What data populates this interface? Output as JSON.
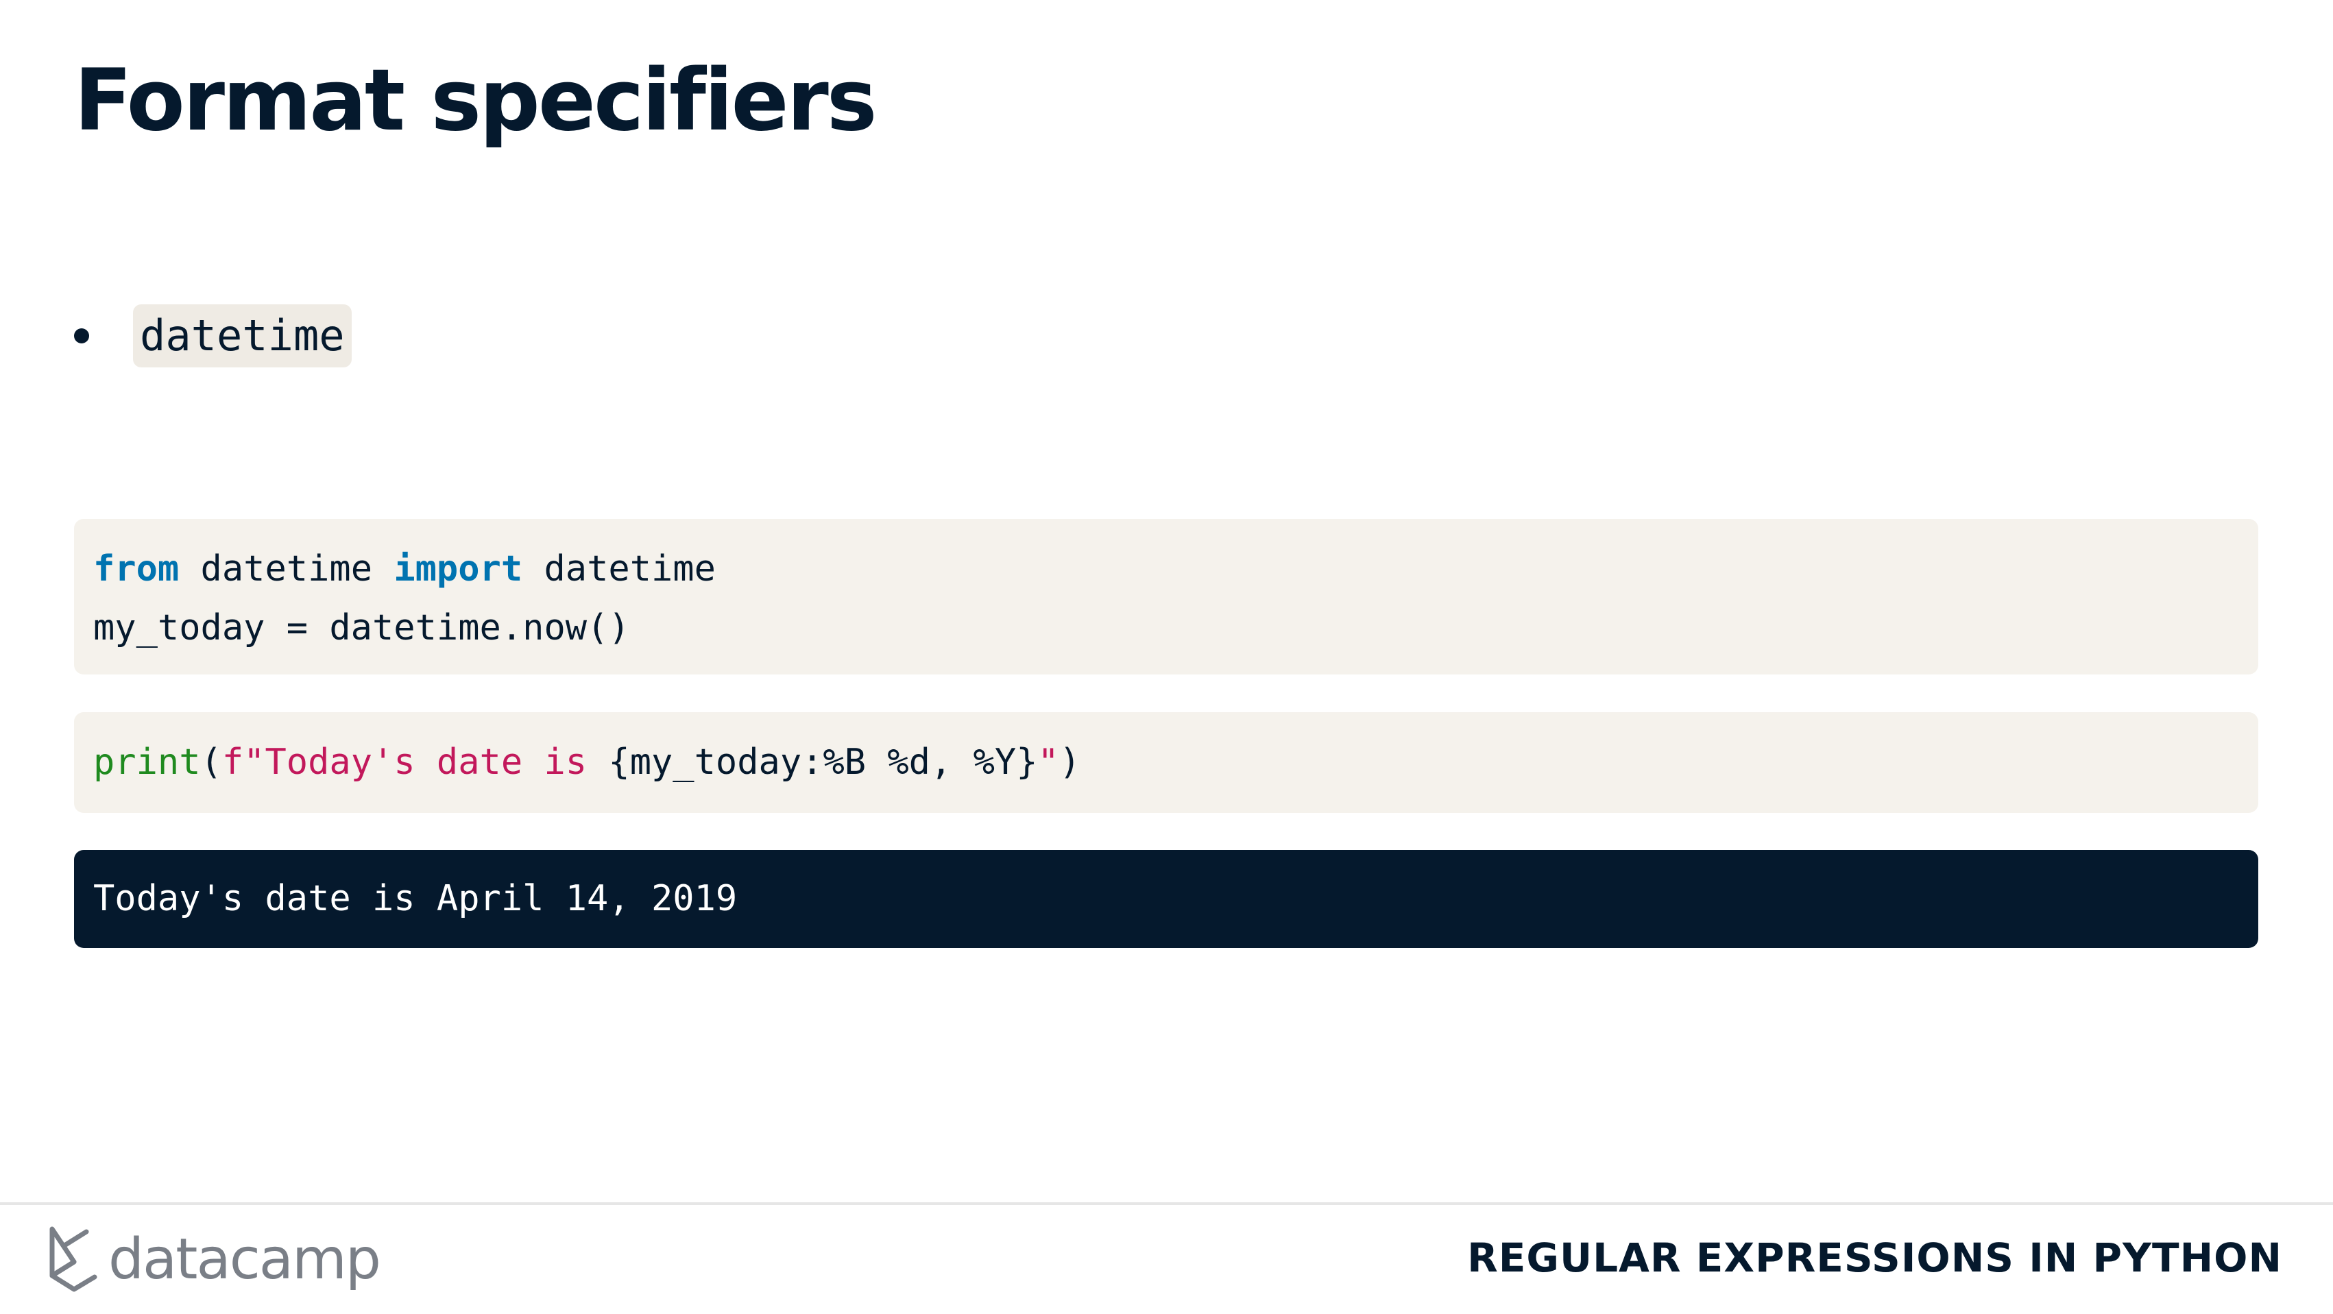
{
  "slide": {
    "title": "Format specifiers"
  },
  "bullet": {
    "text": "datetime"
  },
  "code_block_1": {
    "line1": {
      "kw_from": "from",
      "module": " datetime ",
      "kw_import": "import",
      "name": " datetime"
    },
    "line2": "my_today = datetime.now()"
  },
  "code_block_2": {
    "fn_print": "print",
    "paren_open": "(",
    "str_start": "f\"Today's date is ",
    "expr": "{my_today:%B %d, %Y}",
    "str_end": "\"",
    "paren_close": ")"
  },
  "output": {
    "text": "Today's date is April 14, 2019"
  },
  "footer": {
    "logo_text": "datacamp",
    "course": "REGULAR EXPRESSIONS IN PYTHON"
  },
  "colors": {
    "title": "#05192d",
    "code_bg": "#f5f2ec",
    "output_bg": "#05192d",
    "keyword": "#0073b0",
    "function": "#1f8a1f",
    "string": "#c2185b",
    "logo": "#7a7f87"
  },
  "icons": {
    "logo": "datacamp-logo-icon",
    "bullet": "bullet-dot-icon"
  }
}
